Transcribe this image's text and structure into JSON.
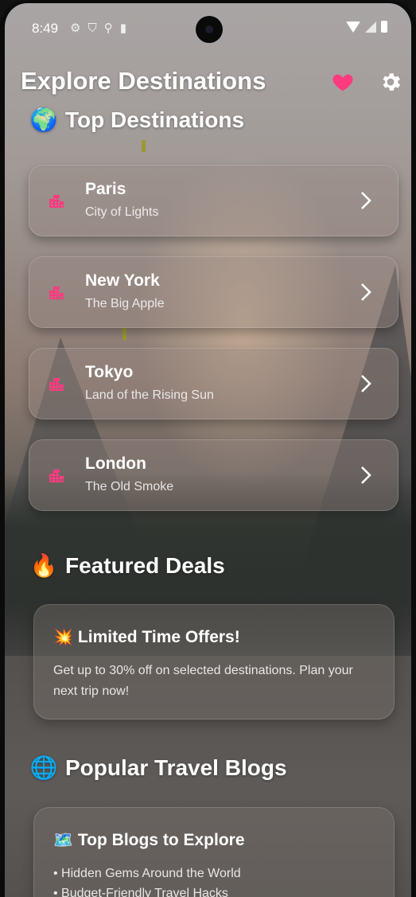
{
  "status_bar": {
    "time": "8:49",
    "left_icons": [
      "gear-icon",
      "shield-icon",
      "usb-icon",
      "sd-card-icon"
    ],
    "right_icons": [
      "wifi-icon",
      "signal-icon",
      "battery-icon"
    ]
  },
  "header": {
    "title": "Explore Destinations",
    "favorite_icon": "heart-icon",
    "settings_icon": "gear-icon",
    "accent_color": "#ff3b7f"
  },
  "top_destinations": {
    "emoji": "🌍",
    "title": "Top Destinations",
    "items": [
      {
        "name": "Paris",
        "subtitle": "City of Lights",
        "icon": "city-icon"
      },
      {
        "name": "New York",
        "subtitle": "The Big Apple",
        "icon": "city-icon"
      },
      {
        "name": "Tokyo",
        "subtitle": "Land of the Rising Sun",
        "icon": "city-icon"
      },
      {
        "name": "London",
        "subtitle": "The Old Smoke",
        "icon": "city-icon"
      }
    ]
  },
  "featured_deals": {
    "emoji": "🔥",
    "title": "Featured Deals",
    "card": {
      "emoji": "💥",
      "title": "Limited Time Offers!",
      "body": "Get up to 30% off on selected destinations. Plan your next trip now!"
    }
  },
  "travel_blogs": {
    "emoji": "🌐",
    "title": "Popular Travel Blogs",
    "card": {
      "emoji": "🗺️",
      "title": "Top Blogs to Explore",
      "items": [
        "• Hidden Gems Around the World",
        "• Budget-Friendly Travel Hacks"
      ]
    }
  }
}
